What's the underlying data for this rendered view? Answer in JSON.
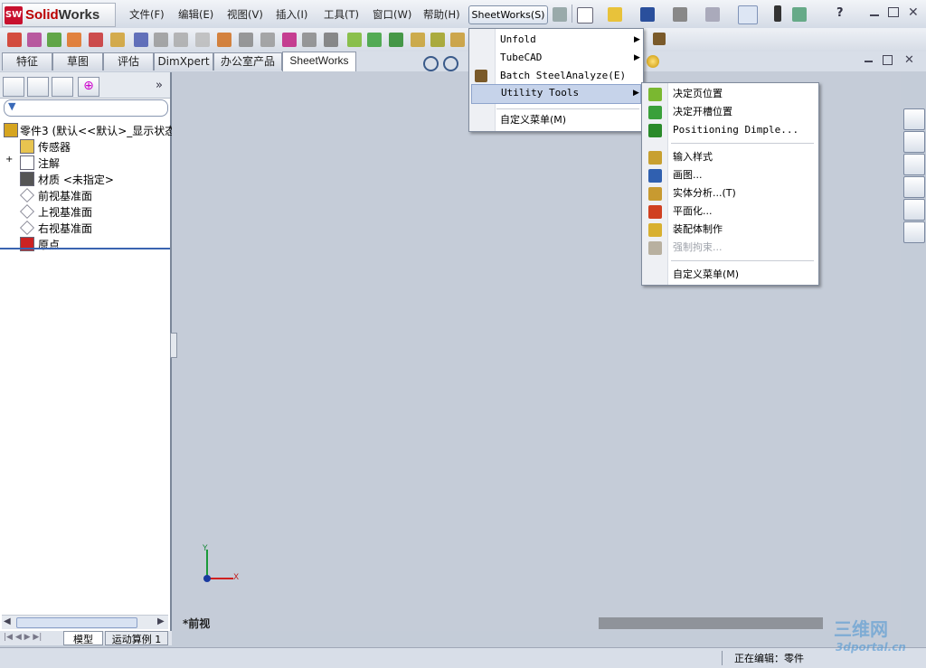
{
  "app": {
    "logo_text_1": "Solid",
    "logo_text_2": "Works"
  },
  "menubar": {
    "items": [
      "文件(F)",
      "编辑(E)",
      "视图(V)",
      "插入(I)",
      "工具(T)",
      "窗口(W)",
      "帮助(H)"
    ],
    "sheetworks": "SheetWorks(S)"
  },
  "tabs": [
    "特征",
    "草图",
    "评估",
    "DimXpert",
    "办公室产品",
    "SheetWorks"
  ],
  "active_tab": "SheetWorks",
  "feature_tree": {
    "root": "零件3   (默认<<默认>_显示状态",
    "items": [
      "传感器",
      "注解",
      "材质 <未指定>",
      "前视基准面",
      "上视基准面",
      "右视基准面",
      "原点"
    ]
  },
  "sheetworks_menu": {
    "items": [
      "Unfold",
      "TubeCAD",
      "Batch SteelAnalyze(E)",
      "Utility Tools",
      "自定义菜单(M)"
    ]
  },
  "utility_menu": {
    "items": [
      "决定页位置",
      "决定开槽位置",
      "Positioning Dimple...",
      "输入样式",
      "画图...",
      "实体分析...(T)",
      "平面化...",
      "装配体制作",
      "强制拘束...",
      "自定义菜单(M)"
    ]
  },
  "graphics": {
    "view_label": "*前视",
    "triad_x": "X",
    "triad_y": "Y"
  },
  "bottom_tabs": [
    "模型",
    "运动算例 1"
  ],
  "status": {
    "editing": "正在编辑：零件"
  },
  "watermark": {
    "line1": "三维网",
    "line2": "3dportal.cn"
  },
  "colors": {
    "accent": "#c8102e",
    "highlight": "#c6d3ea",
    "graphics_bg": "#c5ccd8"
  }
}
